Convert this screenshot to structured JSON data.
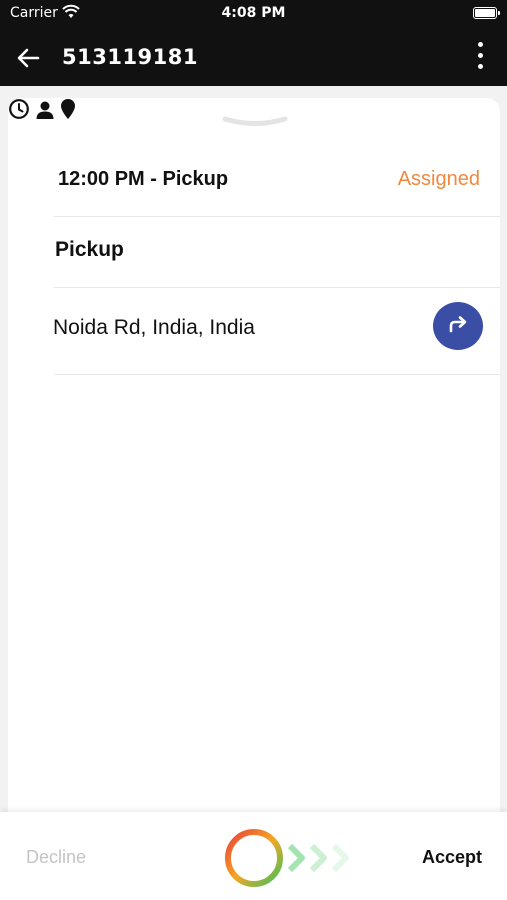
{
  "status_bar": {
    "carrier": "Carrier",
    "time": "4:08 PM"
  },
  "app_bar": {
    "title": "513119181"
  },
  "task": {
    "time_label": "12:00 PM - Pickup",
    "status": "Assigned",
    "task_type": "Pickup",
    "address": "Noida Rd, India, India"
  },
  "actions": {
    "decline_label": "Decline",
    "accept_label": "Accept"
  },
  "colors": {
    "status_assigned": "#f0883e",
    "nav_button": "#3b4ea6",
    "decline_text": "#c4c4c4"
  },
  "icons": {
    "back": "arrow-left-icon",
    "more": "more-vertical-icon",
    "clock": "clock-icon",
    "person": "person-icon",
    "location": "location-pin-icon",
    "navigate": "navigate-arrow-icon"
  }
}
